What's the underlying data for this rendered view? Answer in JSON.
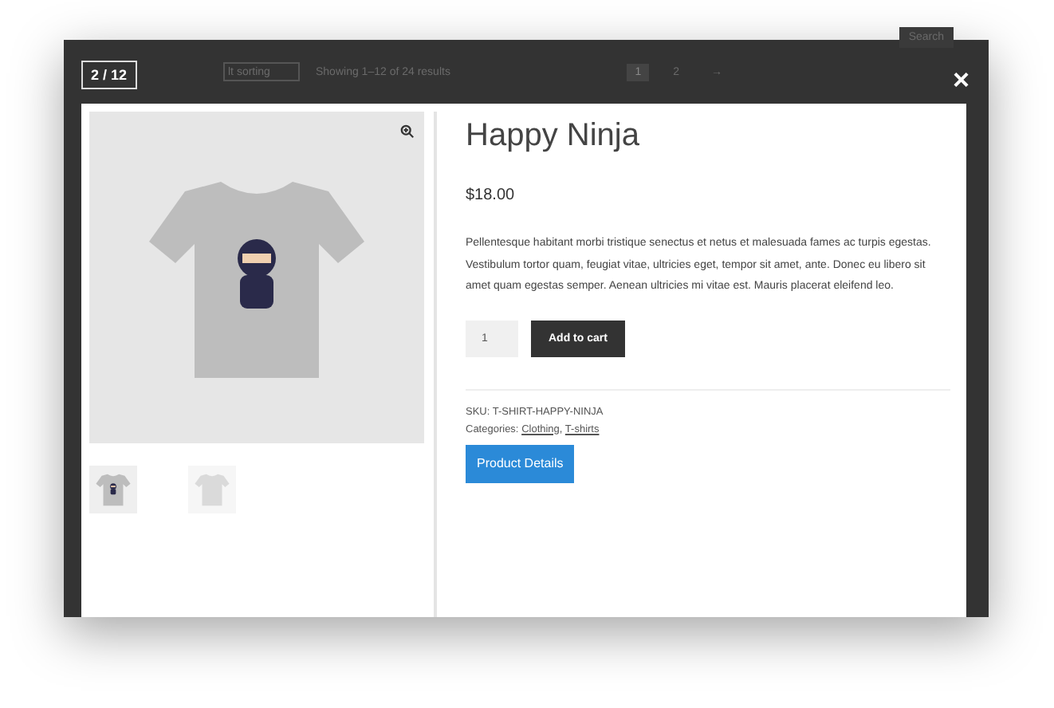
{
  "background_page": {
    "search_button": "Search",
    "sort_select": "lt sorting",
    "result_count": "Showing 1–12 of 24 results",
    "pagination": [
      {
        "label": "1",
        "selected": true
      },
      {
        "label": "2",
        "selected": false
      },
      {
        "label": "→",
        "selected": false
      }
    ]
  },
  "counter": "2 / 12",
  "close": "×",
  "product": {
    "title": "Happy Ninja",
    "price": "$18.00",
    "description": "Pellentesque habitant morbi tristique senectus et netus et malesuada fames ac turpis egestas. Vestibulum tortor quam, feugiat vitae, ultricies eget, tempor sit amet, ante. Donec eu libero sit amet quam egestas semper. Aenean ultricies mi vitae est. Mauris placerat eleifend leo.",
    "quantity": "1",
    "add_to_cart": "Add to cart",
    "sku_label": "SKU:",
    "sku": "T-SHIRT-HAPPY-NINJA",
    "categories_label": "Categories:",
    "categories": [
      "Clothing",
      "T-shirts"
    ],
    "category_separator": ",",
    "details_button": "Product Details"
  },
  "thumbnails": [
    {
      "selected": true
    },
    {
      "selected": false
    }
  ]
}
